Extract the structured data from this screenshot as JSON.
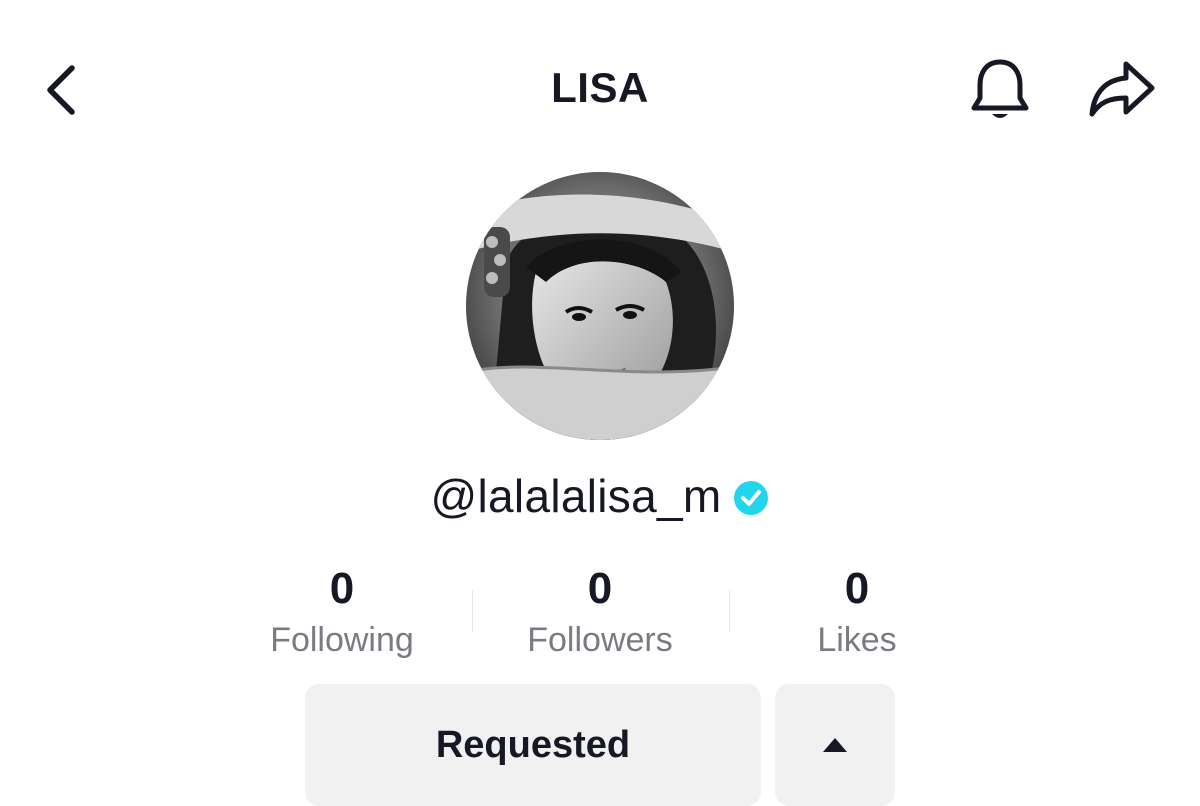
{
  "header": {
    "title": "LISA",
    "back_icon": "chevron-left-icon",
    "bell_icon": "bell-icon",
    "share_icon": "share-arrow-icon"
  },
  "profile": {
    "avatar_description": "grayscale portrait photo",
    "username": "@lalalalisa_m",
    "verified": true,
    "verified_color": "#20d5ec"
  },
  "stats": [
    {
      "value": "0",
      "label": "Following"
    },
    {
      "value": "0",
      "label": "Followers"
    },
    {
      "value": "0",
      "label": "Likes"
    }
  ],
  "actions": {
    "primary_label": "Requested",
    "suggest_icon": "caret-up-icon"
  }
}
